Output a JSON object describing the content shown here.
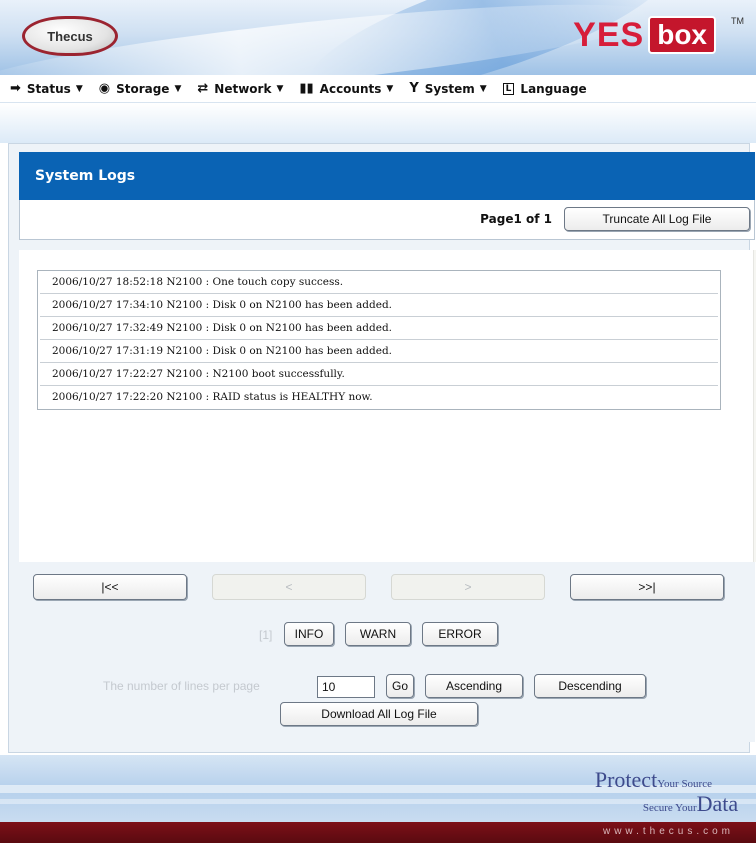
{
  "header": {
    "logo_text": "Thecus",
    "brand_yes": "YES",
    "brand_box": "box",
    "trademark": "TM"
  },
  "menu": [
    {
      "label": "Status",
      "icon": "status-arrow-icon"
    },
    {
      "label": "Storage",
      "icon": "storage-disc-icon"
    },
    {
      "label": "Network",
      "icon": "network-arrows-icon"
    },
    {
      "label": "Accounts",
      "icon": "accounts-people-icon"
    },
    {
      "label": "System",
      "icon": "system-tools-icon"
    },
    {
      "label": "Language",
      "icon": "language-icon"
    }
  ],
  "panel": {
    "title": "System Logs",
    "page_info": "Page1 of  1",
    "truncate_label": "Truncate All Log File"
  },
  "logs": [
    "2006/10/27 18:52:18 N2100 : One touch copy success.",
    "2006/10/27 17:34:10 N2100 : Disk 0 on N2100 has been added.",
    "2006/10/27 17:32:49 N2100 : Disk 0 on N2100 has been added.",
    "2006/10/27 17:31:19 N2100 : Disk 0 on N2100 has been added.",
    "2006/10/27 17:22:27 N2100 : N2100 boot successfully.",
    "2006/10/27 17:22:20 N2100 : RAID status is HEALTHY now."
  ],
  "navigation": {
    "first": "|<<",
    "prev": "<",
    "next": ">",
    "last": ">>|",
    "page_index": "[1]",
    "info": "INFO",
    "warn": "WARN",
    "error": "ERROR",
    "lines_label": "The number of lines per page",
    "lines_value": "10",
    "go": "Go",
    "ascending": "Ascending",
    "descending": "Descending",
    "download": "Download All Log File"
  },
  "footer": {
    "protect": "Protect",
    "your_source": "Your Source",
    "secure_your": "Secure Your",
    "data": "Data",
    "url": "www.thecus.com"
  },
  "colors": {
    "title_bar": "#0a63b4",
    "brand_red": "#d71d3a",
    "bottom_bar": "#6b0d14"
  }
}
